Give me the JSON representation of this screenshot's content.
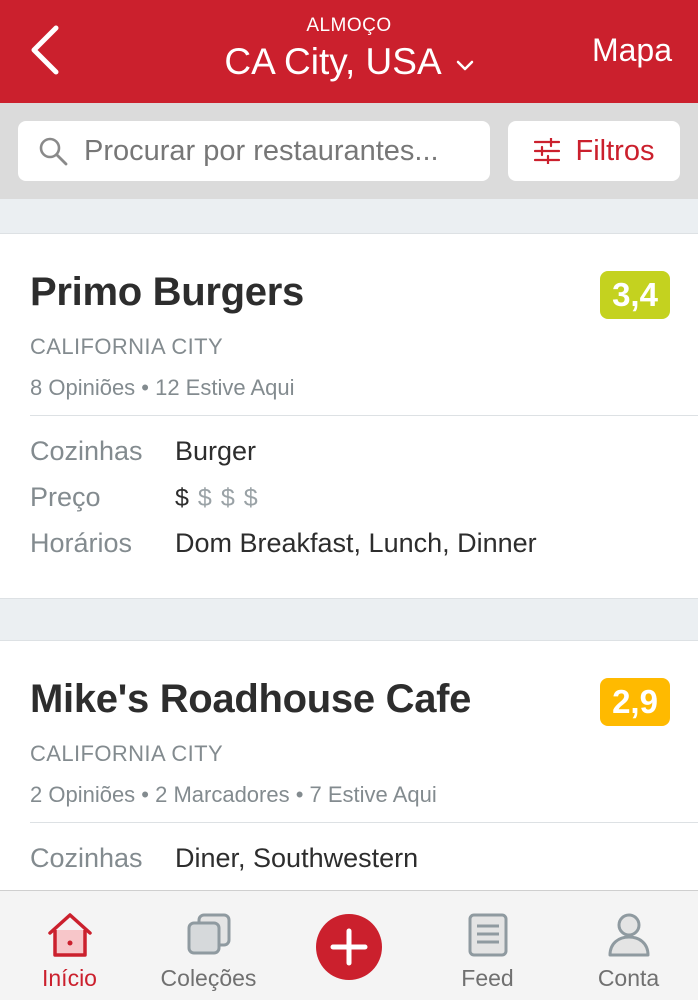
{
  "header": {
    "meal": "ALMOÇO",
    "city": "CA City, USA",
    "map_label": "Mapa"
  },
  "search": {
    "placeholder": "Procurar por restaurantes...",
    "filter_label": "Filtros"
  },
  "labels": {
    "cuisines": "Cozinhas",
    "price": "Preço",
    "hours": "Horários"
  },
  "restaurants": [
    {
      "name": "Primo Burgers",
      "rating": "3,4",
      "rating_color": "#c4d21f",
      "locality": "CALIFORNIA CITY",
      "stats": "8 Opiniões • 12 Estive Aqui",
      "cuisines": "Burger",
      "price_level": 1,
      "price_max": 4,
      "hours": "Dom Breakfast, Lunch, Dinner"
    },
    {
      "name": "Mike's Roadhouse Cafe",
      "rating": "2,9",
      "rating_color": "#ffba00",
      "locality": "CALIFORNIA CITY",
      "stats": "2 Opiniões • 2 Marcadores • 7 Estive Aqui",
      "cuisines": "Diner, Southwestern"
    }
  ],
  "nav": {
    "home": "Início",
    "collections": "Coleções",
    "feed": "Feed",
    "account": "Conta"
  },
  "colors": {
    "brand": "#cb202d"
  }
}
